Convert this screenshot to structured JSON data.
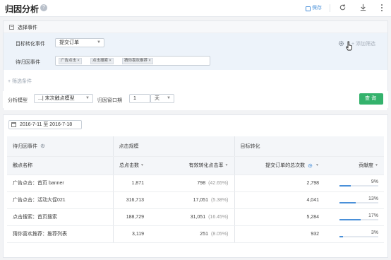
{
  "header": {
    "title": "归因分析",
    "help_glyph": "?",
    "save_label": "保存"
  },
  "filter": {
    "section_title": "选择事件",
    "target_label": "目标转化事件",
    "target_value": "提交订单",
    "add_filter_label": "添加筛选",
    "pending_label": "待归因事件",
    "tags": [
      {
        "label": "广告点击"
      },
      {
        "label": "点击搜索"
      },
      {
        "label": "猜你喜欢推荐"
      }
    ],
    "add_condition_label": "筛选条件"
  },
  "model": {
    "model_label": "分析模型",
    "model_value": "...| 末次触点模型",
    "window_label": "归因窗口期",
    "window_value": "1",
    "window_unit": "天",
    "query_label": "查询"
  },
  "date_range": "2016-7-11 至 2016-7-18",
  "table": {
    "group_headers": {
      "events": "待归因事件",
      "clicks": "点击规模",
      "conversion": "目标转化"
    },
    "columns": {
      "name": "触点名称",
      "total_clicks": "总点击数",
      "effective_rate": "有效转化点击率",
      "total_orders": "提交订单的总次数",
      "contribution": "贡献度"
    },
    "rows": [
      {
        "name": "广告点击：首页 banner",
        "clicks": "1,871",
        "effective": "798",
        "effective_pct": "(42.65%)",
        "orders": "2,798",
        "contribution": "9%",
        "contribution_value": 9
      },
      {
        "name": "广告点击：活动大促021",
        "clicks": "316,713",
        "effective": "17,051",
        "effective_pct": "(5.38%)",
        "orders": "4,041",
        "contribution": "13%",
        "contribution_value": 13
      },
      {
        "name": "点击搜索：首页搜索",
        "clicks": "188,729",
        "effective": "31,051",
        "effective_pct": "(16.45%)",
        "orders": "5,284",
        "contribution": "17%",
        "contribution_value": 17
      },
      {
        "name": "猜你喜欢推荐：推荐列表",
        "clicks": "3,119",
        "effective": "251",
        "effective_pct": "(8.05%)",
        "orders": "932",
        "contribution": "3%",
        "contribution_value": 3
      }
    ]
  },
  "colors": {
    "accent": "#4a90d9",
    "query_button": "#34b26c"
  },
  "icons": [
    "help-icon",
    "save-icon",
    "refresh-icon",
    "download-icon",
    "more-icon",
    "collapse-icon",
    "gear-icon",
    "cursor-icon",
    "calendar-icon",
    "sort-icon"
  ]
}
